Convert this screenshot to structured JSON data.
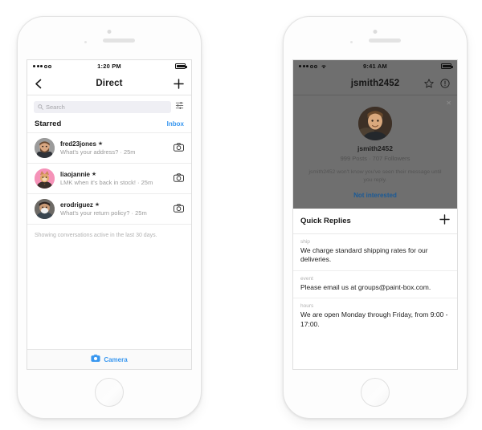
{
  "colors": {
    "accent_blue": "#3897f0",
    "link_blue": "#1b5a96",
    "overlay_gray": "#6f6f6f",
    "muted_text": "#9a9a9a",
    "search_bg": "#efeff4"
  },
  "left_phone": {
    "status_bar": {
      "carrier_signal": "●●●○○",
      "time": "1:20 PM",
      "battery": "battery-icon"
    },
    "nav": {
      "back_icon": "chevron-left-icon",
      "title": "Direct",
      "compose_icon": "plus-icon"
    },
    "search": {
      "placeholder": "Search",
      "search_icon": "search-icon",
      "filter_icon": "filter-sliders-icon"
    },
    "section": {
      "title": "Starred",
      "action": "Inbox"
    },
    "conversations": [
      {
        "username": "fred23jones",
        "starred": "★",
        "snippet": "What's your address? · 25m",
        "avatar": "avatar-fred23jones",
        "camera_icon": "camera-icon"
      },
      {
        "username": "liaojannie",
        "starred": "★",
        "snippet": "LMK when it's back in stock! · 25m",
        "avatar": "avatar-liaojannie",
        "camera_icon": "camera-icon"
      },
      {
        "username": "erodriguez",
        "starred": "★",
        "snippet": "What's your return policy? · 25m",
        "avatar": "avatar-erodriguez",
        "camera_icon": "camera-icon"
      }
    ],
    "footnote": "Showing conversations active in the last 30 days.",
    "bottom_bar": {
      "camera_icon": "camera-icon",
      "label": "Camera"
    }
  },
  "right_phone": {
    "status_bar": {
      "carrier_signal": "●●●○○",
      "wifi": "wifi-icon",
      "time": "9:41 AM",
      "battery": "battery-icon"
    },
    "nav": {
      "title": "jsmith2452",
      "star_icon": "star-outline-icon",
      "info_icon": "info-circle-icon"
    },
    "profile_overlay": {
      "close_icon": "close-x-icon",
      "avatar": "avatar-jsmith2452",
      "username": "jsmith2452",
      "stats": "999 Posts  ·  707 Followers",
      "note": "jsmith2452 won't know you've seen their message until you reply.",
      "action": "Not interested"
    },
    "quick_replies": {
      "title": "Quick Replies",
      "add_icon": "plus-icon",
      "items": [
        {
          "shortcut": "ship",
          "text": "We charge standard shipping rates for our deliveries."
        },
        {
          "shortcut": "event",
          "text": "Please email us at groups@paint-box.com."
        },
        {
          "shortcut": "hours",
          "text": "We are open Monday through Friday, from 9:00 - 17:00."
        }
      ]
    }
  }
}
